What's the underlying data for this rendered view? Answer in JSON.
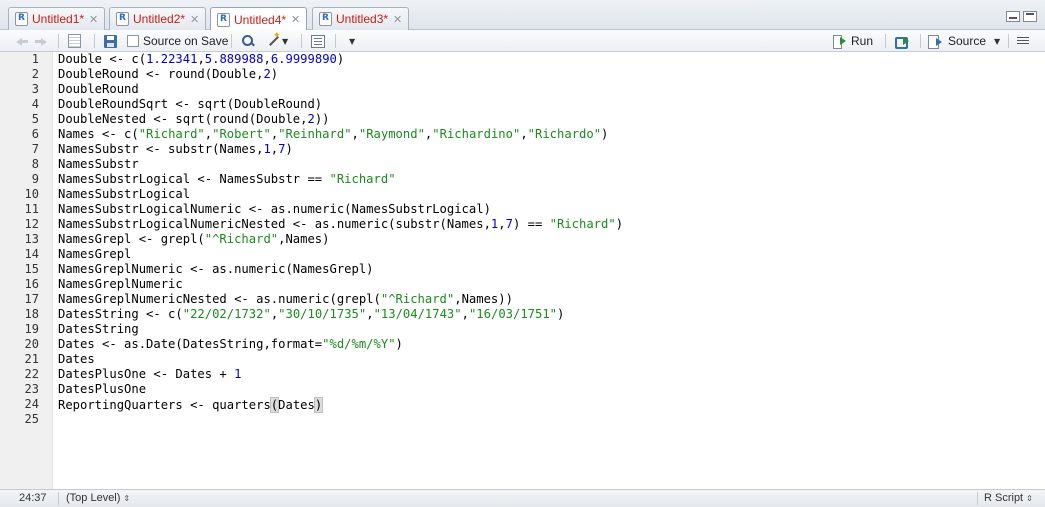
{
  "tabs": [
    {
      "label": "Untitled1*",
      "active": false
    },
    {
      "label": "Untitled2*",
      "active": false
    },
    {
      "label": "Untitled4*",
      "active": true
    },
    {
      "label": "Untitled3*",
      "active": false
    }
  ],
  "toolbar": {
    "source_on_save_label": "Source on Save",
    "run_label": "Run",
    "source_label": "Source"
  },
  "code_lines": [
    [
      [
        "Double <- c(",
        ""
      ],
      [
        "1.22341",
        "n"
      ],
      [
        ",",
        ""
      ],
      [
        "5.889988",
        "n"
      ],
      [
        ",",
        ""
      ],
      [
        "6.9999890",
        "n"
      ],
      [
        ")",
        ""
      ]
    ],
    [
      [
        "DoubleRound <- round(Double,",
        ""
      ],
      [
        "2",
        "n"
      ],
      [
        ")",
        ""
      ]
    ],
    [
      [
        "DoubleRound",
        ""
      ]
    ],
    [
      [
        "DoubleRoundSqrt <- sqrt(DoubleRound)",
        ""
      ]
    ],
    [
      [
        "DoubleNested <- sqrt(round(Double,",
        ""
      ],
      [
        "2",
        "n"
      ],
      [
        "))",
        ""
      ]
    ],
    [
      [
        "Names <- c(",
        ""
      ],
      [
        "\"Richard\"",
        "s"
      ],
      [
        ",",
        ""
      ],
      [
        "\"Robert\"",
        "s"
      ],
      [
        ",",
        ""
      ],
      [
        "\"Reinhard\"",
        "s"
      ],
      [
        ",",
        ""
      ],
      [
        "\"Raymond\"",
        "s"
      ],
      [
        ",",
        ""
      ],
      [
        "\"Richardino\"",
        "s"
      ],
      [
        ",",
        ""
      ],
      [
        "\"Richardo\"",
        "s"
      ],
      [
        ")",
        ""
      ]
    ],
    [
      [
        "NamesSubstr <- substr(Names,",
        ""
      ],
      [
        "1",
        "n"
      ],
      [
        ",",
        ""
      ],
      [
        "7",
        "n"
      ],
      [
        ")",
        ""
      ]
    ],
    [
      [
        "NamesSubstr",
        ""
      ]
    ],
    [
      [
        "NamesSubstrLogical <- NamesSubstr == ",
        ""
      ],
      [
        "\"Richard\"",
        "s"
      ]
    ],
    [
      [
        "NamesSubstrLogical",
        ""
      ]
    ],
    [
      [
        "NamesSubstrLogicalNumeric <- as.numeric(NamesSubstrLogical)",
        ""
      ]
    ],
    [
      [
        "NamesSubstrLogicalNumericNested <- as.numeric(substr(Names,",
        ""
      ],
      [
        "1",
        "n"
      ],
      [
        ",",
        ""
      ],
      [
        "7",
        "n"
      ],
      [
        ") == ",
        ""
      ],
      [
        "\"Richard\"",
        "s"
      ],
      [
        ")",
        ""
      ]
    ],
    [
      [
        "NamesGrepl <- grepl(",
        ""
      ],
      [
        "\"^Richard\"",
        "s"
      ],
      [
        ",Names)",
        ""
      ]
    ],
    [
      [
        "NamesGrepl",
        ""
      ]
    ],
    [
      [
        "NamesGreplNumeric <- as.numeric(NamesGrepl)",
        ""
      ]
    ],
    [
      [
        "NamesGreplNumeric",
        ""
      ]
    ],
    [
      [
        "NamesGreplNumericNested <- as.numeric(grepl(",
        ""
      ],
      [
        "\"^Richard\"",
        "s"
      ],
      [
        ",Names))",
        ""
      ]
    ],
    [
      [
        "DatesString <- c(",
        ""
      ],
      [
        "\"22/02/1732\"",
        "s"
      ],
      [
        ",",
        ""
      ],
      [
        "\"30/10/1735\"",
        "s"
      ],
      [
        ",",
        ""
      ],
      [
        "\"13/04/1743\"",
        "s"
      ],
      [
        ",",
        ""
      ],
      [
        "\"16/03/1751\"",
        "s"
      ],
      [
        ")",
        ""
      ]
    ],
    [
      [
        "DatesString",
        ""
      ]
    ],
    [
      [
        "Dates <- as.Date(DatesString,format=",
        ""
      ],
      [
        "\"%d/%m/%Y\"",
        "s"
      ],
      [
        ")",
        ""
      ]
    ],
    [
      [
        "Dates",
        ""
      ]
    ],
    [
      [
        "DatesPlusOne <- Dates + ",
        ""
      ],
      [
        "1",
        "n"
      ]
    ],
    [
      [
        "DatesPlusOne",
        ""
      ]
    ],
    [
      [
        "ReportingQuarters <- quarters",
        ""
      ],
      [
        "(",
        "h"
      ],
      [
        "Dates",
        ""
      ],
      [
        ")",
        "h"
      ],
      [
        "|",
        "c"
      ]
    ],
    []
  ],
  "status": {
    "position": "24:37",
    "scope": "(Top Level)",
    "file_type": "R Script"
  }
}
